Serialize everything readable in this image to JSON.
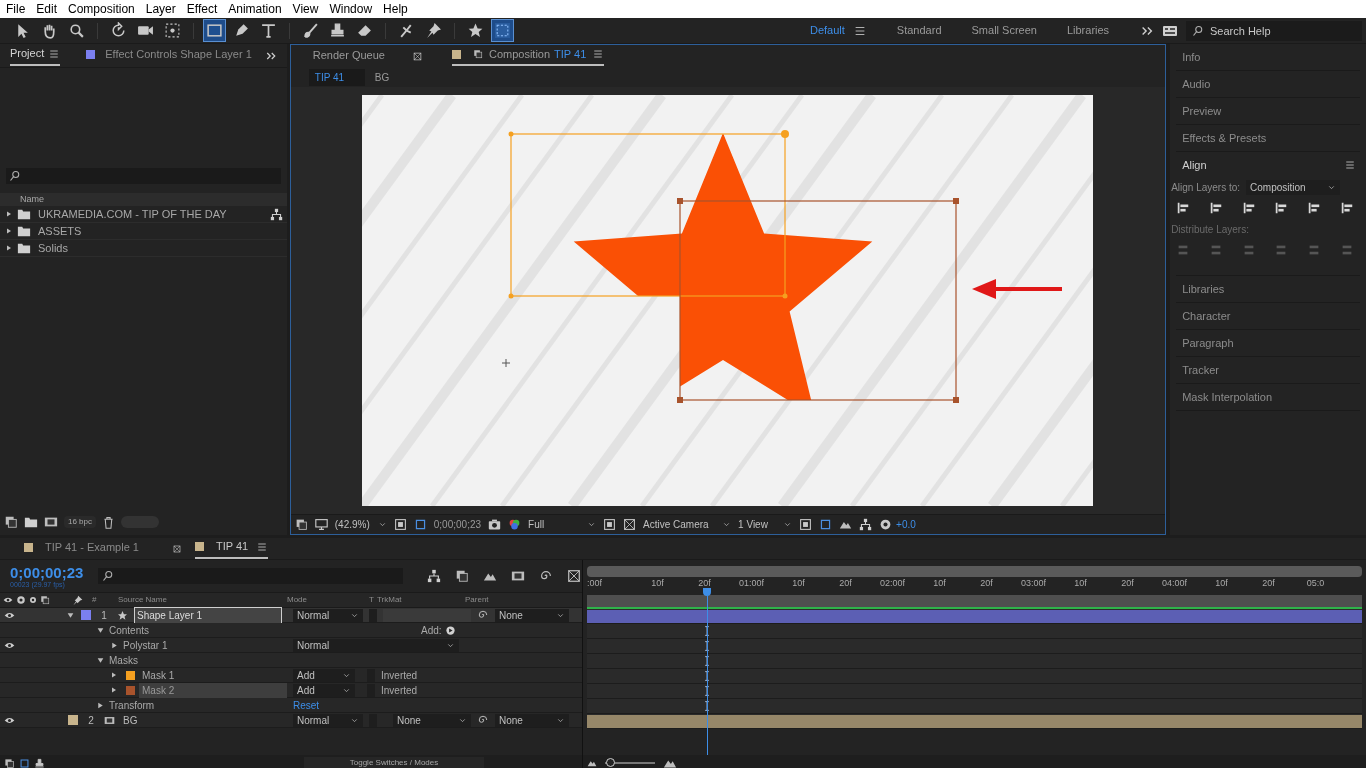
{
  "menu": [
    "File",
    "Edit",
    "Composition",
    "Layer",
    "Effect",
    "Animation",
    "View",
    "Window",
    "Help"
  ],
  "tools": [
    {
      "kind": "select",
      "selected": false
    },
    {
      "kind": "hand",
      "selected": false
    },
    {
      "kind": "zoom",
      "selected": false
    },
    {
      "kind": "rotate",
      "selected": false
    },
    {
      "kind": "camera",
      "selected": false
    },
    {
      "kind": "pan",
      "selected": false
    },
    {
      "kind": "rectangle",
      "selected": true
    },
    {
      "kind": "pen",
      "selected": false
    },
    {
      "kind": "text",
      "selected": false
    },
    {
      "kind": "brush",
      "selected": false
    },
    {
      "kind": "stamp",
      "selected": false
    },
    {
      "kind": "eraser",
      "selected": false
    },
    {
      "kind": "roto",
      "selected": false
    },
    {
      "kind": "pin",
      "selected": false
    },
    {
      "kind": "star",
      "selected": false
    },
    {
      "kind": "grid",
      "selected": true
    }
  ],
  "workspaces": [
    {
      "label": "Default",
      "selected": true
    },
    {
      "label": "Standard",
      "selected": false
    },
    {
      "label": "Small Screen",
      "selected": false
    },
    {
      "label": "Libraries",
      "selected": false
    }
  ],
  "search_help": {
    "placeholder": "Search Help"
  },
  "project_panel": {
    "tabs": [
      {
        "label": "Project",
        "selected": true
      },
      {
        "label": "Effect Controls Shape Layer 1",
        "selected": false
      }
    ],
    "column": "Name",
    "items": [
      {
        "label": "UKRAMEDIA.COM - TIP OF THE DAY"
      },
      {
        "label": "ASSETS"
      },
      {
        "label": "Solids"
      }
    ],
    "bpc": "16 bpc"
  },
  "composition_panel": {
    "tabs": [
      {
        "label": "Render Queue",
        "selected": false
      },
      {
        "label": "Composition",
        "name": "TIP 41",
        "selected": true
      }
    ],
    "breadcrumbs": [
      {
        "label": "TIP 41",
        "selected": true
      },
      {
        "label": "BG",
        "selected": false
      }
    ],
    "footer": {
      "zoom": "(42.9%)",
      "timecode": "0;00;00;23",
      "resolution": "Full",
      "camera": "Active Camera",
      "views": "1 View",
      "exposure": "+0.0"
    }
  },
  "right_panels": [
    {
      "label": "Info",
      "expanded": false
    },
    {
      "label": "Audio",
      "expanded": false
    },
    {
      "label": "Preview",
      "expanded": false
    },
    {
      "label": "Effects & Presets",
      "expanded": false
    },
    {
      "label": "Align",
      "expanded": true
    },
    {
      "label": "Libraries",
      "expanded": false
    },
    {
      "label": "Character",
      "expanded": false
    },
    {
      "label": "Paragraph",
      "expanded": false
    },
    {
      "label": "Tracker",
      "expanded": false
    },
    {
      "label": "Mask Interpolation",
      "expanded": false
    }
  ],
  "align": {
    "align_layers_to_label": "Align Layers to:",
    "align_layers_to": "Composition",
    "distribute_label": "Distribute Layers:"
  },
  "timeline": {
    "tabs": [
      {
        "label": "TIP 41 - Example 1",
        "selected": false
      },
      {
        "label": "TIP 41",
        "selected": true
      }
    ],
    "timecode": "0;00;00;23",
    "frame_info": "00023 (29.97 fps)",
    "columns": [
      "#",
      "Source Name",
      "Mode",
      "T",
      "TrkMat",
      "Parent"
    ],
    "ruler": [
      ":00f",
      "10f",
      "20f",
      "01:00f",
      "10f",
      "20f",
      "02:00f",
      "10f",
      "20f",
      "03:00f",
      "10f",
      "20f",
      "04:00f",
      "10f",
      "20f",
      "05:0"
    ],
    "layers": [
      {
        "kind": "layer",
        "number": "1",
        "name": "Shape Layer 1",
        "color": "#7b7ff0",
        "visible": true,
        "selected": true,
        "mode": "Normal",
        "parent": "None",
        "children": [
          {
            "kind": "group",
            "name": "Contents",
            "add_label": "Add:",
            "children": [
              {
                "kind": "group",
                "name": "Polystar 1",
                "visible": true,
                "mode": "Normal"
              }
            ]
          },
          {
            "kind": "group",
            "name": "Masks",
            "children": [
              {
                "kind": "mask",
                "name": "Mask 1",
                "color": "#f5a020",
                "selected": false,
                "mode": "Add",
                "inverted": false,
                "inverted_label": "Inverted"
              },
              {
                "kind": "mask",
                "name": "Mask 2",
                "color": "#a8532c",
                "selected": true,
                "mode": "Add",
                "inverted": false,
                "inverted_label": "Inverted"
              }
            ]
          },
          {
            "kind": "group",
            "name": "Transform",
            "reset": "Reset"
          }
        ]
      },
      {
        "kind": "layer",
        "number": "2",
        "name": "BG",
        "color": "#c8b48c",
        "visible": true,
        "selected": false,
        "mode": "Normal",
        "trkmat": "None",
        "parent": "None"
      }
    ],
    "zoom_slider": {
      "level": 0.1
    },
    "footer": "Toggle Switches / Modes"
  }
}
